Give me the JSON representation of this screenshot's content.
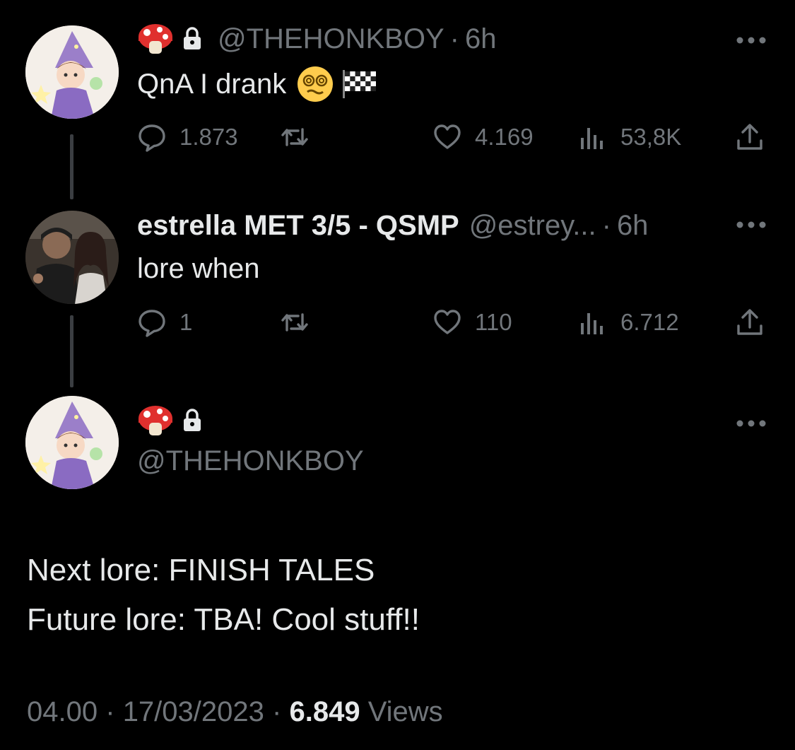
{
  "tweet1": {
    "handle": "@THEHONKBOY",
    "separator": "·",
    "time": "6h",
    "text": "QnA I drank",
    "emoji_icons": [
      "mushroom-icon",
      "lock-icon"
    ],
    "inline_icons": [
      "dizzy-face-emoji-icon",
      "checkered-flag-icon"
    ],
    "actions": {
      "replies": "1.873",
      "retweets": "",
      "likes": "4.169",
      "views": "53,8K"
    }
  },
  "tweet2": {
    "display_name": "estrella MET 3/5 - QSMP",
    "handle": "@estrey...",
    "separator": "·",
    "time": "6h",
    "text": "lore when",
    "actions": {
      "replies": "1",
      "retweets": "",
      "likes": "110",
      "views": "6.712"
    }
  },
  "main_tweet": {
    "handle": "@THEHONKBOY",
    "body_lines": [
      "Next lore: FINISH TALES",
      "Future lore: TBA! Cool stuff!!"
    ],
    "footer": {
      "time": "04.00",
      "sep": "·",
      "date": "17/03/2023",
      "views_count": "6.849",
      "views_label": "Views"
    }
  },
  "colors": {
    "background": "#000000",
    "text": "#e7e9ea",
    "muted": "#71767b",
    "thread_line": "#3b3e42"
  }
}
